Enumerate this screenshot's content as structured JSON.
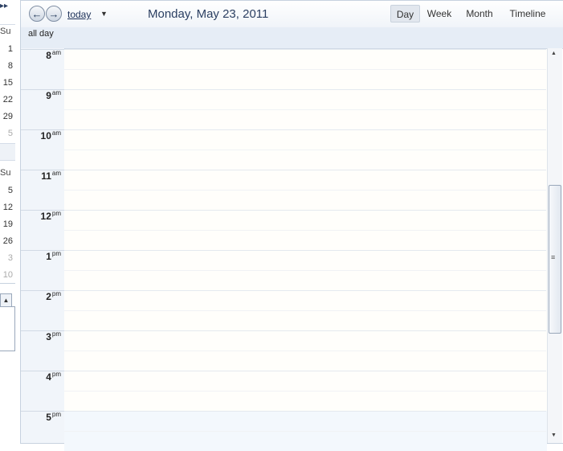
{
  "mini_calendar": {
    "top": {
      "day_header": "Su",
      "days": [
        "1",
        "8",
        "15",
        "22",
        "29",
        "5"
      ]
    },
    "bottom": {
      "day_header": "Su",
      "days": [
        "5",
        "12",
        "19",
        "26",
        "3",
        "10"
      ]
    },
    "nav_icon": "double-arrow-right-icon"
  },
  "toolbar": {
    "today_label": "today",
    "date_title": "Monday, May 23, 2011",
    "views": {
      "day": "Day",
      "week": "Week",
      "month": "Month",
      "timeline": "Timeline"
    }
  },
  "allday_label": "all day",
  "hours": [
    {
      "h": "8",
      "s": "am"
    },
    {
      "h": "9",
      "s": "am"
    },
    {
      "h": "10",
      "s": "am"
    },
    {
      "h": "11",
      "s": "am"
    },
    {
      "h": "12",
      "s": "pm"
    },
    {
      "h": "1",
      "s": "pm"
    },
    {
      "h": "2",
      "s": "pm"
    },
    {
      "h": "3",
      "s": "pm"
    },
    {
      "h": "4",
      "s": "pm"
    },
    {
      "h": "5",
      "s": "pm"
    }
  ],
  "colors": {
    "working_hours_bg": "#fffefb",
    "after_hours_bg": "#f3f8fd",
    "accent": "#2b3f62"
  }
}
